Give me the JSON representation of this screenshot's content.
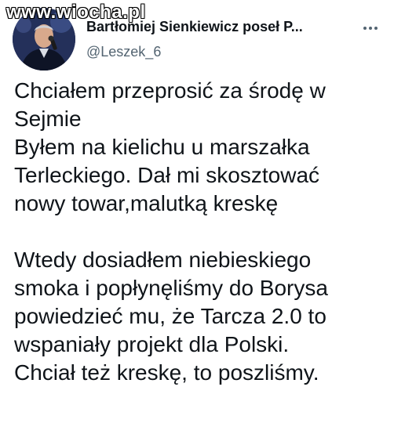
{
  "watermark": "www.wiocha.pl",
  "author": {
    "display_name": "Bartłomiej Sienkiewicz poseł P...",
    "handle": "@Leszek_6",
    "avatar_icon": "profile-photo"
  },
  "more_icon": "more-dots-icon",
  "tweet": {
    "paragraph1": [
      "Chciałem przeprosić za środę w",
      "Sejmie",
      "Byłem na kielichu u marszałka",
      "Terleckiego. Dał mi skosztować",
      "nowy towar,malutką kreskę"
    ],
    "paragraph2": [
      "Wtedy dosiadłem niebieskiego",
      "smoka i popłynęliśmy do Borysa",
      "powiedzieć mu, że Tarcza 2.0 to",
      "wspaniały projekt dla Polski.",
      "Chciał też kreskę, to poszliśmy."
    ]
  },
  "colors": {
    "text": "#0f1419",
    "secondary": "#536471",
    "background": "#ffffff"
  }
}
